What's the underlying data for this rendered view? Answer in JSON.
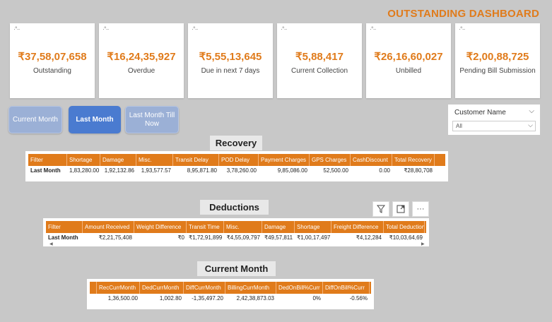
{
  "header": {
    "title": "OUTSTANDING DASHBOARD"
  },
  "kpis": [
    {
      "value": "₹37,58,07,658",
      "label": "Outstanding"
    },
    {
      "value": "₹16,24,35,927",
      "label": "Overdue"
    },
    {
      "value": "₹5,55,13,645",
      "label": "Due in next 7 days"
    },
    {
      "value": "₹5,88,417",
      "label": "Current Collection"
    },
    {
      "value": "₹26,16,60,027",
      "label": "Unbilled"
    },
    {
      "value": "₹2,00,88,725",
      "label": "Pending Bill Submission"
    }
  ],
  "period_buttons": [
    {
      "label": "Current Month"
    },
    {
      "label": "Last Month"
    },
    {
      "label": "Last Month Till Now"
    }
  ],
  "slicer": {
    "title": "Customer Name",
    "selected": "All"
  },
  "recovery": {
    "title": "Recovery",
    "headers": [
      "Filter",
      "Shortage",
      "Damage",
      "Misc.",
      "Transit Delay",
      "POD Delay",
      "Payment Charges",
      "GPS Charges",
      "CashDiscount",
      "Total Recovery"
    ],
    "row": [
      "Last Month",
      "1,83,280.00",
      "1,92,132.86",
      "1,93,577.57",
      "8,95,871.80",
      "3,78,260.00",
      "9,85,086.00",
      "52,500.00",
      "0.00",
      "₹28,80,708"
    ]
  },
  "deductions": {
    "title": "Deductions",
    "headers": [
      "Filter",
      "Amount Received",
      "Weight Difference",
      "Transit Time",
      "Misc.",
      "Damage",
      "Shortage",
      "Freight Difference",
      "Total Deduction"
    ],
    "row": [
      "Last Month",
      "₹2,21,75,408",
      "₹0",
      "₹1,72,91,899",
      "₹4,55,09,797",
      "₹49,57,811",
      "₹1,00,17,497",
      "₹4,12,284",
      "₹10,03,64,69"
    ]
  },
  "current_month": {
    "title": "Current Month",
    "headers": [
      "",
      "RecCurrMonth",
      "DedCurrMonth",
      "DiffCurrMonth",
      "BillingCurrMonth",
      "DedOnBill%Curr",
      "DiffOnBill%Curr"
    ],
    "row": [
      "",
      "1,36,500.00",
      "1,002.80",
      "-1,35,497.20",
      "2,42,38,873.03",
      "0%",
      "-0.56%"
    ]
  },
  "colors": {
    "accent": "#e07b1b",
    "active_button": "#4a7bd0",
    "inactive_button": "#9bb0d6",
    "background": "#c8c8c8"
  }
}
